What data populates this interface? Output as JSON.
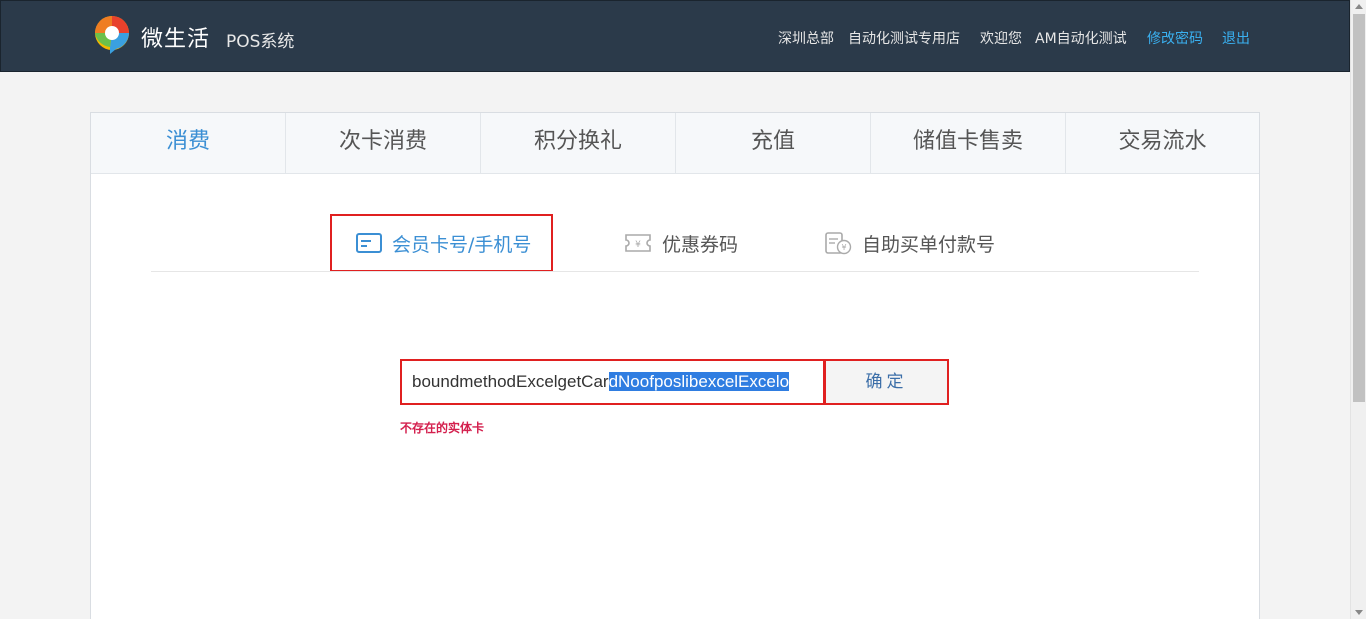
{
  "header": {
    "brand": "微生活",
    "brand_sub": "POS系统",
    "store_hq": "深圳总部",
    "store_name": "自动化测试专用店",
    "welcome": "欢迎您",
    "user": "AM自动化测试",
    "change_password": "修改密码",
    "logout": "退出"
  },
  "tabs": [
    {
      "label": "消费"
    },
    {
      "label": "次卡消费"
    },
    {
      "label": "积分换礼"
    },
    {
      "label": "充值"
    },
    {
      "label": "储值卡售卖"
    },
    {
      "label": "交易流水"
    }
  ],
  "subtabs": [
    {
      "label": "会员卡号/手机号",
      "icon": "card-icon"
    },
    {
      "label": "优惠券码",
      "icon": "coupon-icon"
    },
    {
      "label": "自助买单付款号",
      "icon": "receipt-icon"
    }
  ],
  "form": {
    "input_text_unselected": "boundmethodExcelgetCar",
    "input_text_selected": "dNoofposlibexcelExcelo",
    "confirm": "确定",
    "error": "不存在的实体卡"
  },
  "colors": {
    "header_bg": "#2b3a4a",
    "accent": "#3b8fd4",
    "link": "#3ab0f0",
    "error": "#d4204e",
    "highlight_border": "#e02020"
  }
}
